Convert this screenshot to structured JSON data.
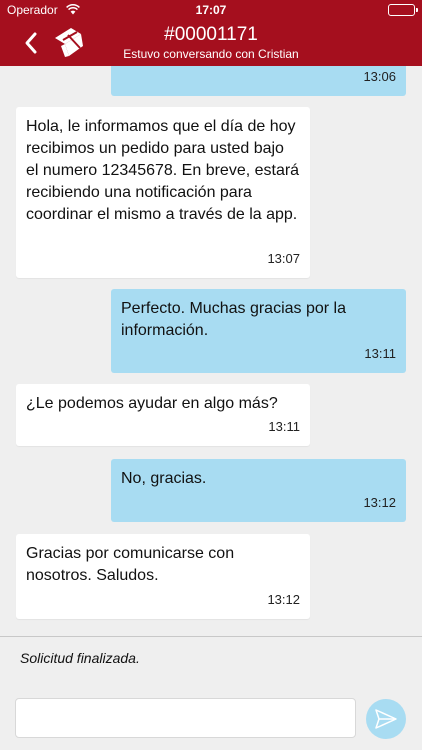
{
  "status_bar": {
    "carrier": "Operador",
    "time": "17:07"
  },
  "header": {
    "title": "#00001171",
    "subtitle": "Estuvo conversando con Cristian"
  },
  "messages": [
    {
      "direction": "outgoing",
      "text": "",
      "time": "13:06"
    },
    {
      "direction": "incoming",
      "text": "Hola, le informamos que el día de hoy recibimos un pedido para usted bajo el numero 12345678. En breve, estará recibiendo una notificación para coordinar el mismo a través de la app.",
      "time": "13:07"
    },
    {
      "direction": "outgoing",
      "text": "Perfecto. Muchas gracias por la información.",
      "time": "13:11"
    },
    {
      "direction": "incoming",
      "text": "¿Le podemos ayudar en algo más?",
      "time": "13:11"
    },
    {
      "direction": "outgoing",
      "text": "No, gracias.",
      "time": "13:12"
    },
    {
      "direction": "incoming",
      "text": "Gracias por comunicarse con nosotros. Saludos.",
      "time": "13:12"
    }
  ],
  "request_status": "Solicitud finalizada.",
  "composer": {
    "value": "",
    "placeholder": ""
  },
  "colors": {
    "brand": "#a50f1e",
    "outgoing_bubble": "#a8dcf2",
    "incoming_bubble": "#ffffff",
    "background": "#efefef"
  },
  "icons": {
    "back": "chevron-left-icon",
    "logo": "brand-logo",
    "send": "paper-plane-icon",
    "wifi": "wifi-icon",
    "battery": "battery-icon"
  }
}
